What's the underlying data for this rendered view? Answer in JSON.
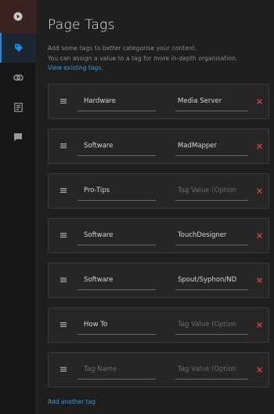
{
  "sidebar": {
    "items": [
      {
        "icon": "circle-play-icon",
        "active": false
      },
      {
        "icon": "tag-icon",
        "active": true
      },
      {
        "icon": "link-icon",
        "active": false
      },
      {
        "icon": "template-icon",
        "active": false
      },
      {
        "icon": "comment-icon",
        "active": false
      }
    ]
  },
  "panel": {
    "title": "Page Tags",
    "description_line1": "Add some tags to better categorise your content.",
    "description_line2": "You can assign a value to a tag for more in-depth organisation.",
    "view_link": "View existing tags."
  },
  "tags": [
    {
      "name": "Hardware",
      "value": "Media Server"
    },
    {
      "name": "Software",
      "value": "MadMapper"
    },
    {
      "name": "Pro-Tips",
      "value": ""
    },
    {
      "name": "Software",
      "value": "TouchDesigner"
    },
    {
      "name": "Software",
      "value": "Spout/Syphon/ND"
    },
    {
      "name": "How To",
      "value": ""
    },
    {
      "name": "",
      "value": ""
    }
  ],
  "placeholders": {
    "name": "Tag Name",
    "value": "Tag Value (Option"
  },
  "add_tag_link": "Add another tag",
  "colors": {
    "accent": "#3a9ae8",
    "remove": "#e0454a",
    "sidebar_top": "#3a2222"
  }
}
